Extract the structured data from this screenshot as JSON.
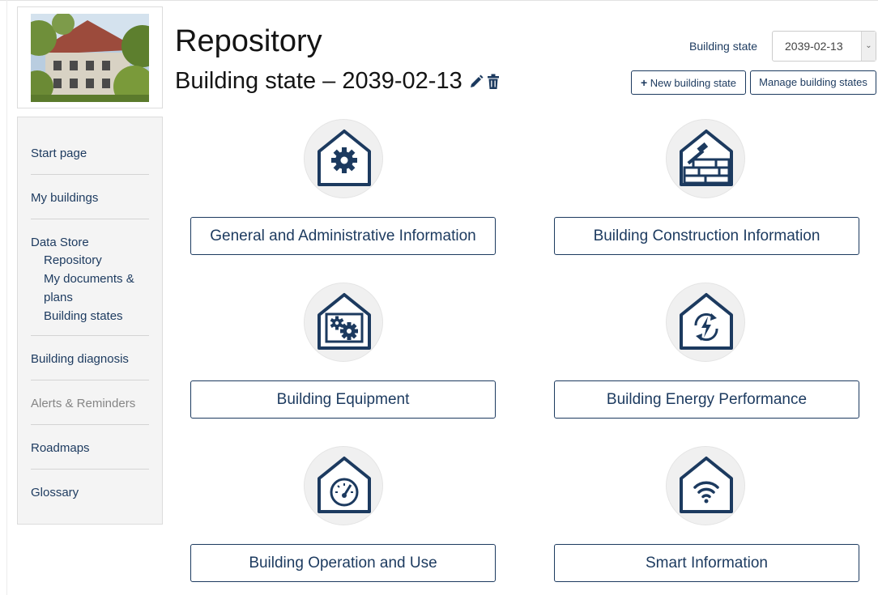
{
  "header": {
    "title": "Repository",
    "subtitle": "Building state – 2039-02-13",
    "building_state_label": "Building state",
    "building_state_value": "2039-02-13",
    "new_building_state": "New building state",
    "manage_building_states": "Manage building states"
  },
  "sidebar": {
    "items": [
      {
        "label": "Start page"
      },
      {
        "label": "My buildings"
      },
      {
        "label": "Data Store",
        "children": [
          "Repository",
          "My documents & plans",
          "Building states"
        ]
      },
      {
        "label": "Building diagnosis"
      },
      {
        "label": "Alerts & Reminders",
        "disabled": true
      },
      {
        "label": "Roadmaps"
      },
      {
        "label": "Glossary"
      }
    ]
  },
  "tiles": [
    {
      "label": "General and Administrative Information",
      "icon": "house-gear-icon"
    },
    {
      "label": "Building Construction Information",
      "icon": "house-bricks-hammer-icon"
    },
    {
      "label": "Building Equipment",
      "icon": "house-gears-icon"
    },
    {
      "label": "Building Energy Performance",
      "icon": "house-energy-cycle-icon"
    },
    {
      "label": "Building Operation and Use",
      "icon": "house-gauge-icon"
    },
    {
      "label": "Smart Information",
      "icon": "house-wifi-icon"
    }
  ],
  "colors": {
    "primary": "#1c3a5f",
    "sidebar_bg": "#f4f4f4",
    "disabled": "#858585"
  }
}
